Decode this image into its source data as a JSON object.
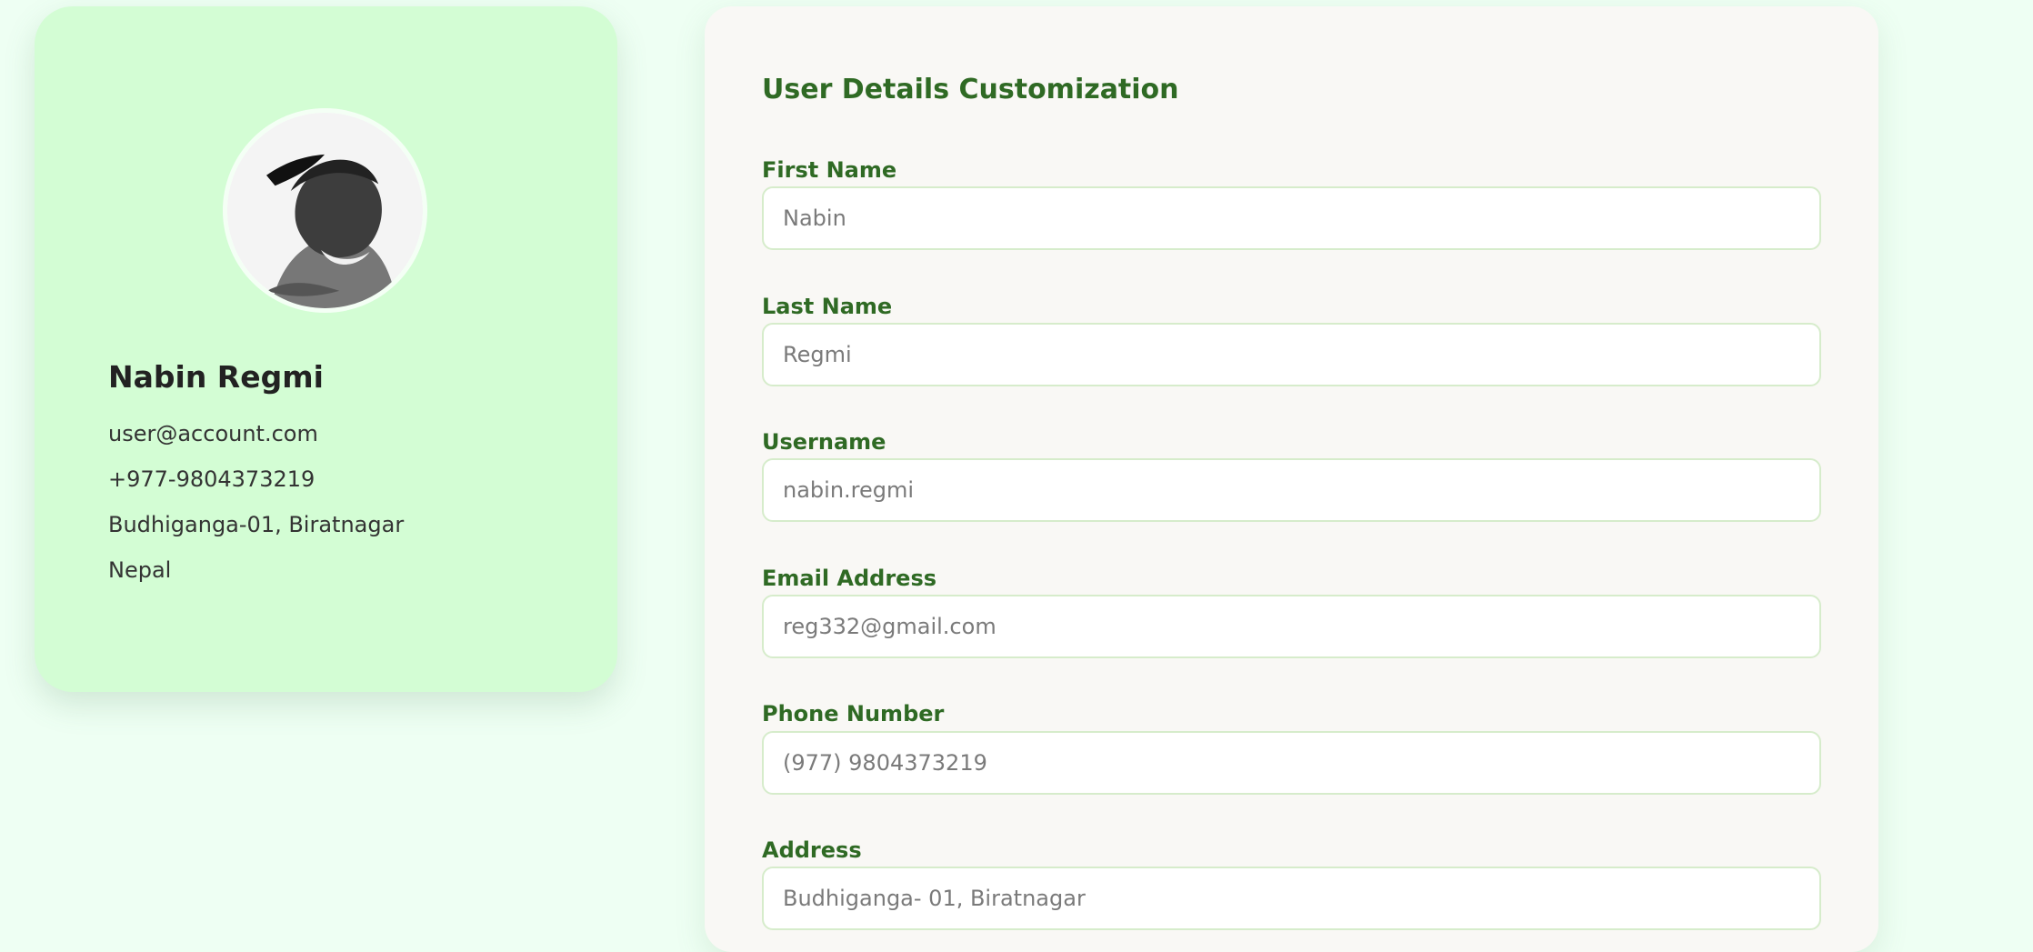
{
  "profile": {
    "name": "Nabin Regmi",
    "email": "user@account.com",
    "phone": "+977-9804373219",
    "address": "Budhiganga-01, Biratnagar",
    "country": "Nepal",
    "avatar_icon": "profile-photo"
  },
  "form": {
    "title": "User Details Customization",
    "fields": [
      {
        "label": "First Name",
        "placeholder": "Nabin"
      },
      {
        "label": "Last Name",
        "placeholder": "Regmi"
      },
      {
        "label": "Username",
        "placeholder": "nabin.regmi"
      },
      {
        "label": "Email Address",
        "placeholder": "reg332@gmail.com"
      },
      {
        "label": "Phone Number",
        "placeholder": "(977) 9804373219"
      },
      {
        "label": "Address",
        "placeholder": "Budhiganga- 01, Biratnagar"
      }
    ]
  },
  "colors": {
    "page_background": "#eefff3",
    "profile_card_background": "#d3fdd4",
    "form_card_background": "#f9f8f5",
    "accent_text": "#2f6a24",
    "input_border": "#d6eccb"
  }
}
